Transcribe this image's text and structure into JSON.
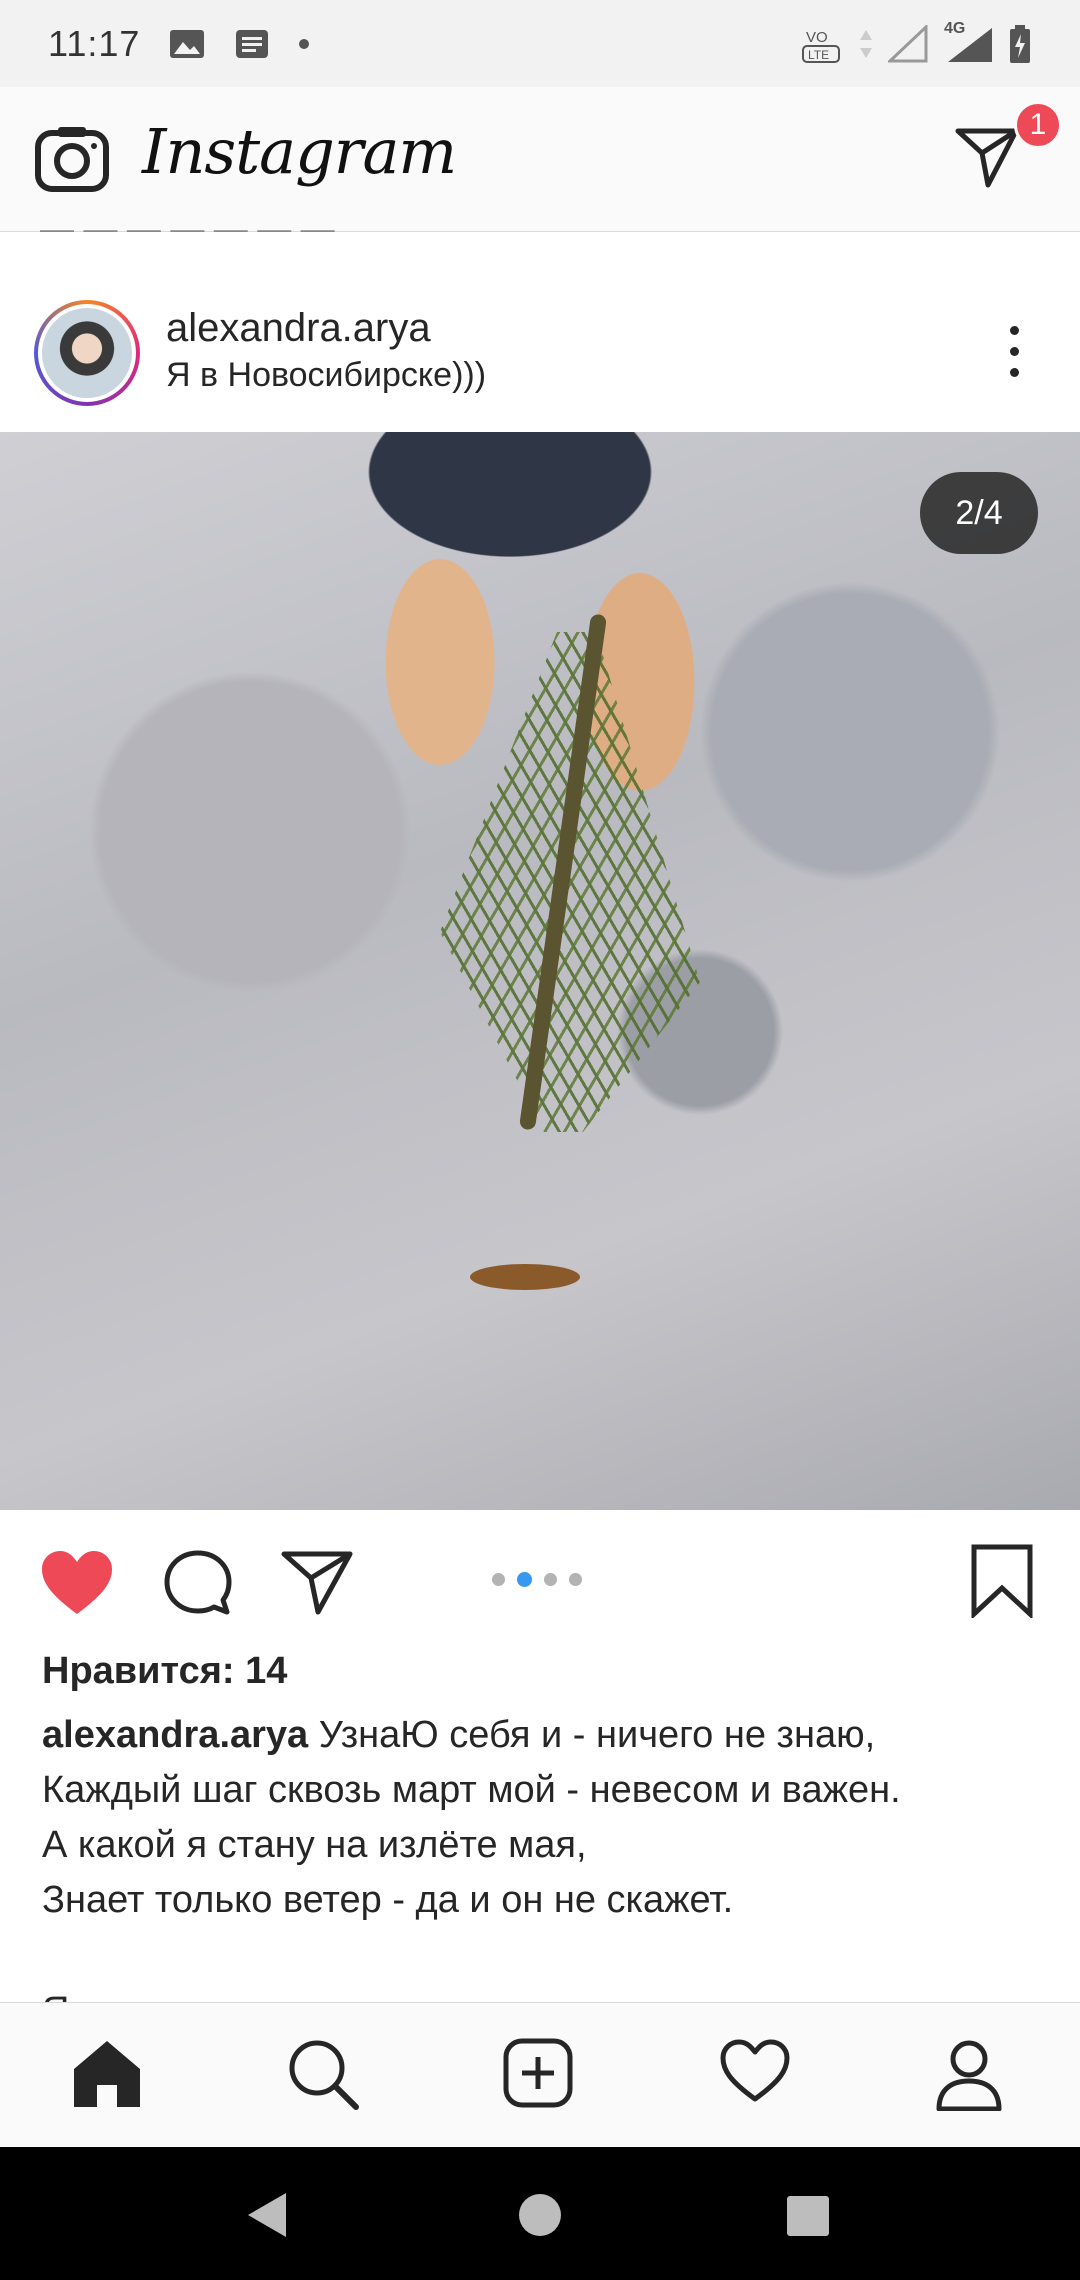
{
  "status_bar": {
    "time": "11:17",
    "network": "4G",
    "volte": "VoLTE"
  },
  "app_bar": {
    "logo": "Instagram",
    "dm_badge": "1"
  },
  "feed": {
    "truncated_text": "— — — — — — —"
  },
  "post": {
    "username": "alexandra.arya",
    "location": "Я в Новосибирске)))",
    "carousel_counter": "2/4",
    "carousel_index": 2,
    "carousel_total": 4,
    "likes": "Нравится: 14",
    "caption_user": "alexandra.arya",
    "caption_lines": [
      "УзнаЮ себя и - ничего не знаю,",
      "Каждый шаг сквозь март мой - невесом и важен.",
      "А какой я стану на излёте мая,",
      "Знает только ветер - да и он не скажет."
    ],
    "caption_more": "Я сама какою..."
  },
  "colors": {
    "like_red": "#ed4956",
    "dot_active": "#3897f0",
    "text": "#262626"
  },
  "icons": {
    "camera": "camera-icon",
    "direct": "direct-message-icon",
    "heart": "heart-filled-icon",
    "comment": "comment-icon",
    "share": "share-icon",
    "bookmark": "bookmark-icon",
    "home": "home-icon",
    "search": "search-icon",
    "add": "add-post-icon",
    "activity": "activity-heart-icon",
    "profile": "profile-icon"
  }
}
